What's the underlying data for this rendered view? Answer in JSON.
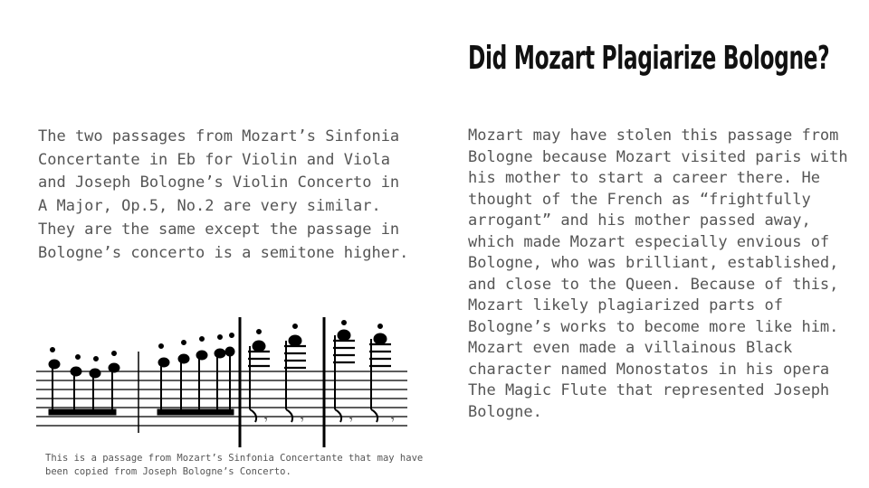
{
  "slide": {
    "title": "Did Mozart Plagiarize Bologne?",
    "left_paragraph": "The two passages from Mozart’s Sinfonia Concertante in Eb for Violin and Viola and Joseph Bologne’s Violin Concerto in A Major, Op.5, No.2 are very similar. They are the same except the passage in Bologne’s concerto is a semitone higher.",
    "right_paragraph": "Mozart may have stolen this passage from Bologne because Mozart visited paris with his mother to start a career there. He thought of the French as “frightfully arrogant” and his mother passed away, which made Mozart especially envious of Bologne, who was brilliant, established, and close to the Queen. Because of this, Mozart likely plagiarized parts of Bologne’s works to become more like him. Mozart even made a villainous Black character named Monostatos in his opera The Magic Flute that represented Joseph Bologne.",
    "image_caption": "This is a passage from Mozart’s Sinfonia Concertante that may have been copied from Joseph Bologne’s Concerto."
  }
}
